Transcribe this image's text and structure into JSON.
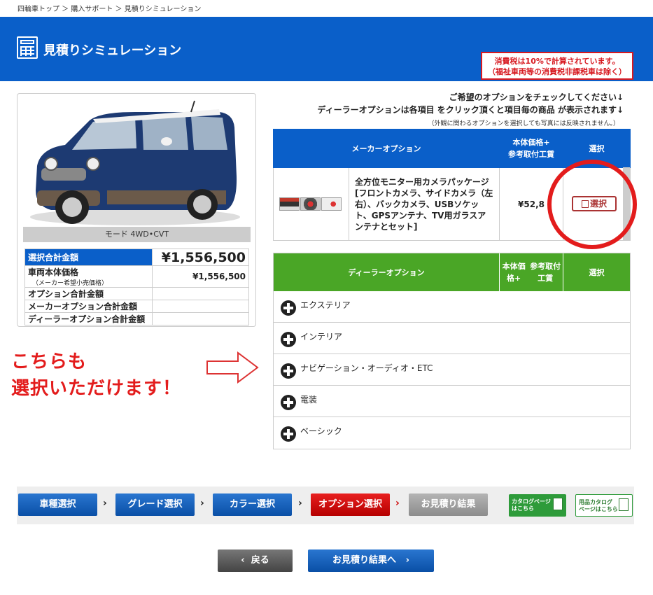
{
  "breadcrumb": "四輪車トップ ＞ 購入サポート ＞ 見積りシミュレーション",
  "header": {
    "title": "見積りシミュレーション",
    "tax_line1": "消費税は10%で計算されています。",
    "tax_line2": "（福祉車両等の消費税非課税車は除く）"
  },
  "car": {
    "model": "モード 4WD•CVT",
    "total_label": "選択合計金額",
    "total_value": "¥1,556,500",
    "body_label": "車両本体価格",
    "body_sub": "（メーカー希望小売価格）",
    "body_value": "¥1,556,500",
    "option_total": "オプション合計金額",
    "maker_total": "メーカーオプション合計金額",
    "dealer_total": "ディーラーオプション合計金額"
  },
  "instructions": {
    "line1": "ご希望のオプションをチェックしてください↓",
    "line2": "ディーラーオプションは各項目 をクリック頂くと項目毎の商品 が表示されます↓",
    "note": "（外観に関わるオプションを選択しても写真には反映されません。）"
  },
  "maker_option": {
    "header": "メーカーオプション",
    "price_header_1": "本体価格+",
    "price_header_2": "参考取付工賃",
    "select_header": "選択",
    "item_name": "全方位モニター用カメラパッケージ[フロントカメラ、サイドカメラ（左右）、バックカメラ、USBソケット、GPSアンテナ、TV用ガラスアンテナとセット]",
    "item_price": "¥52,8",
    "select_label": "選択"
  },
  "dealer_option": {
    "header": "ディーラーオプション",
    "price_header_1": "本体価格+",
    "price_header_2": "参考取付工賃",
    "select_header": "選択",
    "categories": [
      "エクステリア",
      "インテリア",
      "ナビゲーション・オーディオ・ETC",
      "電装",
      "ベーシック"
    ]
  },
  "annotation": {
    "line1": "こちらも",
    "line2": "選択いただけます！"
  },
  "steps": [
    "車種選択",
    "グレード選択",
    "カラー選択",
    "オプション選択",
    "お見積り結果"
  ],
  "catalog": {
    "btn1_line1": "カタログページ",
    "btn1_line2": "はこちら",
    "btn2_line1": "用品カタログ",
    "btn2_line2": "ページはこちら"
  },
  "nav": {
    "back": "戻る",
    "next": "お見積り結果へ"
  },
  "colors": {
    "brand_blue": "#0a5fc9",
    "dealer_green": "#4aa626",
    "active_red": "#e31c1c"
  }
}
